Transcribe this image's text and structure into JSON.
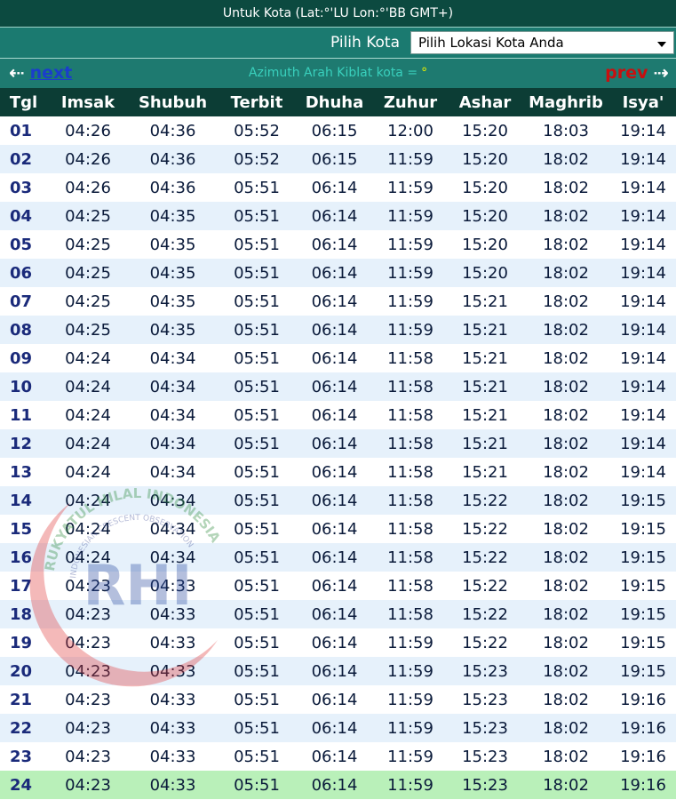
{
  "header": {
    "location_info": "Untuk Kota (Lat:°'LU Lon:°'BB GMT+)"
  },
  "city_select": {
    "label": "Pilih Kota",
    "selected": "Pilih Lokasi Kota Anda"
  },
  "nav": {
    "next_label": "next",
    "prev_label": "prev",
    "next_arrow": "⇠",
    "prev_arrow": "⇢",
    "azimuth_text": "Azimuth Arah Kiblat kota =",
    "azimuth_value": "°"
  },
  "table": {
    "columns": [
      "Tgl",
      "Imsak",
      "Shubuh",
      "Terbit",
      "Dhuha",
      "Zuhur",
      "Ashar",
      "Maghrib",
      "Isya'"
    ],
    "highlighted_day": "24",
    "rows": [
      [
        "01",
        "04:26",
        "04:36",
        "05:52",
        "06:15",
        "12:00",
        "15:20",
        "18:03",
        "19:14"
      ],
      [
        "02",
        "04:26",
        "04:36",
        "05:52",
        "06:15",
        "11:59",
        "15:20",
        "18:02",
        "19:14"
      ],
      [
        "03",
        "04:26",
        "04:36",
        "05:51",
        "06:14",
        "11:59",
        "15:20",
        "18:02",
        "19:14"
      ],
      [
        "04",
        "04:25",
        "04:35",
        "05:51",
        "06:14",
        "11:59",
        "15:20",
        "18:02",
        "19:14"
      ],
      [
        "05",
        "04:25",
        "04:35",
        "05:51",
        "06:14",
        "11:59",
        "15:20",
        "18:02",
        "19:14"
      ],
      [
        "06",
        "04:25",
        "04:35",
        "05:51",
        "06:14",
        "11:59",
        "15:20",
        "18:02",
        "19:14"
      ],
      [
        "07",
        "04:25",
        "04:35",
        "05:51",
        "06:14",
        "11:59",
        "15:21",
        "18:02",
        "19:14"
      ],
      [
        "08",
        "04:25",
        "04:35",
        "05:51",
        "06:14",
        "11:59",
        "15:21",
        "18:02",
        "19:14"
      ],
      [
        "09",
        "04:24",
        "04:34",
        "05:51",
        "06:14",
        "11:58",
        "15:21",
        "18:02",
        "19:14"
      ],
      [
        "10",
        "04:24",
        "04:34",
        "05:51",
        "06:14",
        "11:58",
        "15:21",
        "18:02",
        "19:14"
      ],
      [
        "11",
        "04:24",
        "04:34",
        "05:51",
        "06:14",
        "11:58",
        "15:21",
        "18:02",
        "19:14"
      ],
      [
        "12",
        "04:24",
        "04:34",
        "05:51",
        "06:14",
        "11:58",
        "15:21",
        "18:02",
        "19:14"
      ],
      [
        "13",
        "04:24",
        "04:34",
        "05:51",
        "06:14",
        "11:58",
        "15:21",
        "18:02",
        "19:14"
      ],
      [
        "14",
        "04:24",
        "04:34",
        "05:51",
        "06:14",
        "11:58",
        "15:22",
        "18:02",
        "19:15"
      ],
      [
        "15",
        "04:24",
        "04:34",
        "05:51",
        "06:14",
        "11:58",
        "15:22",
        "18:02",
        "19:15"
      ],
      [
        "16",
        "04:24",
        "04:34",
        "05:51",
        "06:14",
        "11:58",
        "15:22",
        "18:02",
        "19:15"
      ],
      [
        "17",
        "04:23",
        "04:33",
        "05:51",
        "06:14",
        "11:58",
        "15:22",
        "18:02",
        "19:15"
      ],
      [
        "18",
        "04:23",
        "04:33",
        "05:51",
        "06:14",
        "11:58",
        "15:22",
        "18:02",
        "19:15"
      ],
      [
        "19",
        "04:23",
        "04:33",
        "05:51",
        "06:14",
        "11:59",
        "15:22",
        "18:02",
        "19:15"
      ],
      [
        "20",
        "04:23",
        "04:33",
        "05:51",
        "06:14",
        "11:59",
        "15:23",
        "18:02",
        "19:15"
      ],
      [
        "21",
        "04:23",
        "04:33",
        "05:51",
        "06:14",
        "11:59",
        "15:23",
        "18:02",
        "19:16"
      ],
      [
        "22",
        "04:23",
        "04:33",
        "05:51",
        "06:14",
        "11:59",
        "15:23",
        "18:02",
        "19:16"
      ],
      [
        "23",
        "04:23",
        "04:33",
        "05:51",
        "06:14",
        "11:59",
        "15:23",
        "18:02",
        "19:16"
      ],
      [
        "24",
        "04:23",
        "04:33",
        "05:51",
        "06:14",
        "11:59",
        "15:23",
        "18:02",
        "19:16"
      ]
    ]
  },
  "watermark": {
    "letters": "RHI",
    "arc_text": "RUKYATUL HILAL INDONESIA",
    "inner_text": "INDONESIAN CRESCENT OBSERVATION"
  },
  "colors": {
    "header_bg": "#0c4a40",
    "toolbar_bg": "#1b7a70",
    "table_header_bg": "#0c3d35",
    "row_alt": "#e6f1fb",
    "today_row": "#b9f0b9",
    "next_link": "#1a3dcc",
    "prev_link": "#c81010"
  }
}
